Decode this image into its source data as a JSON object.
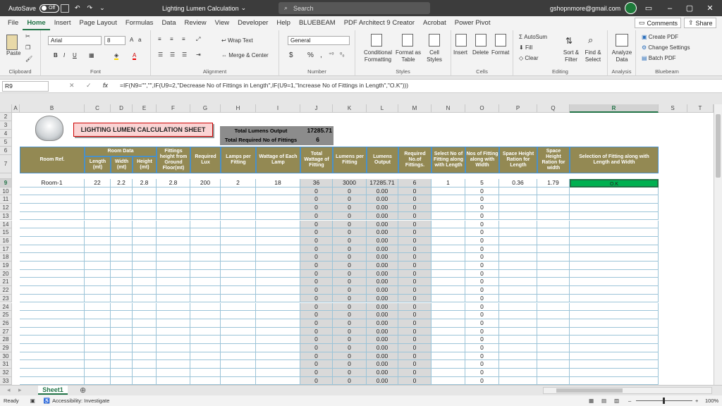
{
  "titlebar": {
    "autosave": "AutoSave",
    "autosave_state": "Off",
    "doc_title": "Lighting Lumen Calculation",
    "search": "Search",
    "email": "gshopnmore@gmail.com"
  },
  "tabs": [
    "File",
    "Home",
    "Insert",
    "Page Layout",
    "Formulas",
    "Data",
    "Review",
    "View",
    "Developer",
    "Help",
    "BLUEBEAM",
    "PDF Architect 9 Creator",
    "Acrobat",
    "Power Pivot"
  ],
  "ribbon_buttons": {
    "comments": "Comments",
    "share": "Share"
  },
  "ribbon": {
    "clipboard": {
      "paste": "Paste",
      "label": "Clipboard"
    },
    "font": {
      "name": "Arial",
      "size": "8",
      "label": "Font",
      "b": "B",
      "i": "I",
      "u": "U"
    },
    "alignment": {
      "wrap": "Wrap Text",
      "merge": "Merge & Center",
      "label": "Alignment"
    },
    "number": {
      "format": "General",
      "label": "Number",
      "currency": "$",
      "percent": "%",
      "comma": ","
    },
    "styles": {
      "cond": "Conditional Formatting",
      "table": "Format as Table",
      "cell": "Cell Styles",
      "label": "Styles"
    },
    "cells": {
      "insert": "Insert",
      "delete": "Delete",
      "format": "Format",
      "label": "Cells"
    },
    "editing": {
      "autosum": "AutoSum",
      "fill": "Fill",
      "clear": "Clear",
      "sort": "Sort & Filter",
      "find": "Find & Select",
      "label": "Editing"
    },
    "analysis": {
      "analyze": "Analyze Data",
      "label": "Analysis"
    },
    "bluebeam": {
      "create": "Create PDF",
      "change": "Change Settings",
      "batch": "Batch PDF",
      "label": "Bluebeam"
    }
  },
  "namebox": "R9",
  "fx": "fx",
  "formula": "=IF(N9=\"\",\"\",IF(U9=2,\"Decrease No of Fittings in Length\",IF(U9=1,\"Increase No of Fittings in Length\",\"O.K\")))",
  "columns": [
    "A",
    "B",
    "C",
    "D",
    "E",
    "F",
    "G",
    "H",
    "I",
    "J",
    "K",
    "L",
    "M",
    "N",
    "O",
    "P",
    "Q",
    "R",
    "S",
    "T"
  ],
  "sheet": {
    "title": "LIGHTING LUMEN CALCULATION SHEET",
    "summary_label_1": "Total Lumens Output",
    "summary_value_1": "17285.71",
    "summary_label_2": "Total Required No of Fittings",
    "summary_value_2": "6",
    "headers": {
      "room_ref": "Room Ref.",
      "room_data": "Room Data",
      "length": "Length (mt)",
      "width": "Width (mt)",
      "height": "Height (mt)",
      "fittings_height": "Fittings height from Ground Floor(mt)",
      "req_lux": "Required Lux",
      "lamps_per": "Lamps per Fitting",
      "wattage_each": "Wattage of Each Lamp",
      "total_wattage": "Total Wattage of Fitting",
      "lumens_per": "Lumens per Fitting",
      "lumens_out": "Lumens Output",
      "req_no": "Required No.of Fittings.",
      "select_no": "Select No of Fitting along with Length",
      "nos_width": "Nos of Fitting along with Width",
      "space_height": "Space Height Ration for Length",
      "space_height_w": "Space Height Ration for width",
      "selection": "Selection of Fitting along with Length and Width"
    },
    "row9": {
      "room": "Room-1",
      "length": "22",
      "width": "2.2",
      "height": "2.8",
      "fh": "2.8",
      "lux": "200",
      "lamps": "2",
      "watt": "18",
      "tw": "36",
      "lpf": "3000",
      "lo": "17285.71",
      "req": "6",
      "sel": "1",
      "nw": "5",
      "shl": "0.36",
      "shw": "1.79",
      "status": "O.K"
    },
    "empty_row": {
      "tw": "0",
      "lpf": "0",
      "lo": "0.00",
      "req": "0",
      "nw": "0"
    },
    "rows": [
      "10",
      "11",
      "12",
      "13",
      "14",
      "15",
      "16",
      "17",
      "18",
      "19",
      "20",
      "21",
      "22",
      "23",
      "24",
      "25",
      "26",
      "27",
      "28",
      "29",
      "30",
      "31",
      "32",
      "33"
    ]
  },
  "sheet_tab": "Sheet1",
  "status": {
    "ready": "Ready",
    "accessibility": "Accessibility: Investigate",
    "zoom": "100%"
  },
  "colors": {
    "header": "#938953",
    "ok": "#00b050",
    "excel_green": "#217346"
  }
}
